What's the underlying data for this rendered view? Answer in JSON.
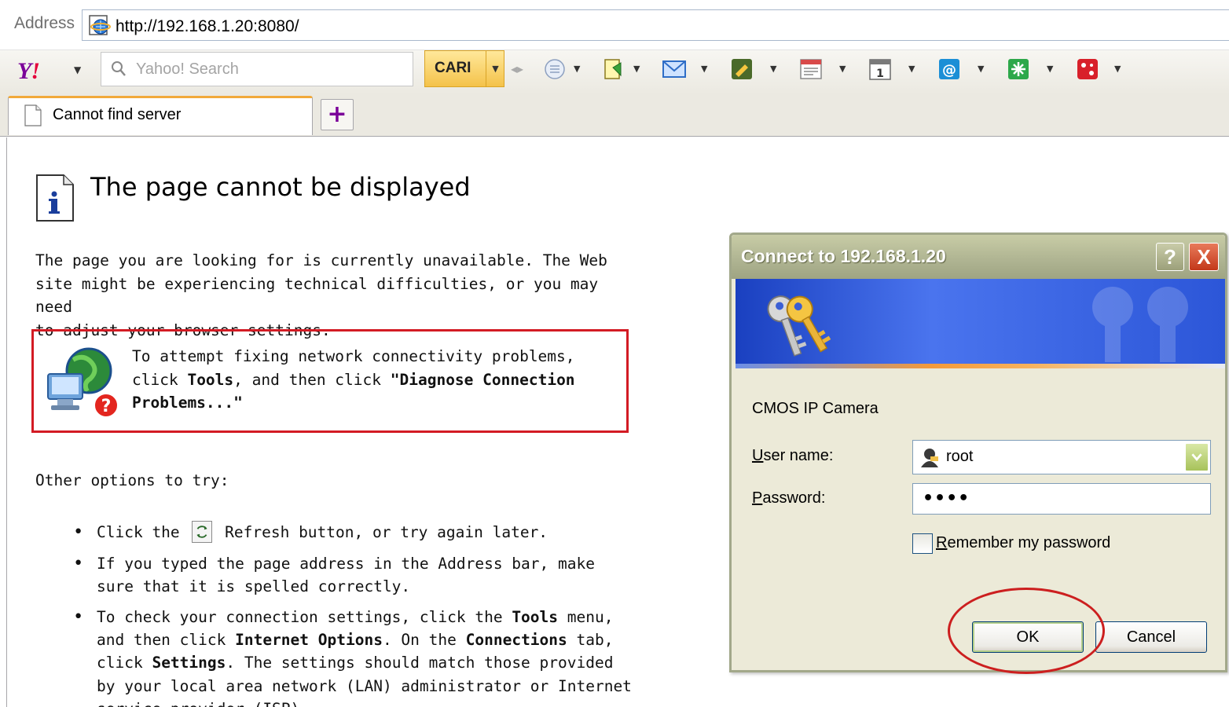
{
  "address_bar": {
    "label": "Address",
    "url": "http://192.168.1.20:8080/"
  },
  "toolbar": {
    "search_placeholder": "Yahoo! Search",
    "search_button_label": "CARI",
    "icons": [
      "yahoo-logo-icon",
      "messenger-icon",
      "bookmark-icon",
      "mail-icon",
      "notepad-icon",
      "news-icon",
      "calendar-icon",
      "answers-icon",
      "weather-icon",
      "games-icon"
    ]
  },
  "tab": {
    "title": "Cannot find server",
    "new_tab_symbol": "+"
  },
  "content": {
    "heading": "The page cannot be displayed",
    "intro": "The page you are looking for is currently unavailable. The Web\nsite might be experiencing technical difficulties, or you may need\nto adjust your browser settings.",
    "diagnose": {
      "p1": "To attempt fixing network connectivity problems, click ",
      "b1": "Tools",
      "p2": ", and then click ",
      "b2": "\"Diagnose Connection Problems...\""
    },
    "other_label": "Other options to try:",
    "options": {
      "o1_a": "Click the ",
      "o1_b": " Refresh button, or try again later.",
      "o2": "If you typed the page address in the Address bar, make sure that it is spelled correctly.",
      "o3_a": "To check your connection settings, click the ",
      "o3_b1": "Tools",
      "o3_c": " menu, and then click ",
      "o3_b2": "Internet Options",
      "o3_d": ". On the ",
      "o3_b3": "Connections",
      "o3_e": " tab, click ",
      "o3_b4": "Settings",
      "o3_f": ". The settings should match those provided by your local area network (LAN) administrator or Internet service provider (ISP)."
    }
  },
  "dialog": {
    "title": "Connect to 192.168.1.20",
    "help_symbol": "?",
    "close_symbol": "X",
    "server_name": "CMOS IP Camera",
    "user_label_acc": "U",
    "user_label_rest": "ser name:",
    "user_value": "root",
    "pass_label_acc": "P",
    "pass_label_rest": "assword:",
    "pass_value": "••••",
    "remember_acc": "R",
    "remember_rest": "emember my password",
    "remember_checked": false,
    "ok_label": "OK",
    "cancel_label": "Cancel"
  },
  "colors": {
    "annotation_red": "#cc1f1f",
    "diagnose_border": "#d31b24",
    "yahoo_purple": "#7b0099"
  }
}
